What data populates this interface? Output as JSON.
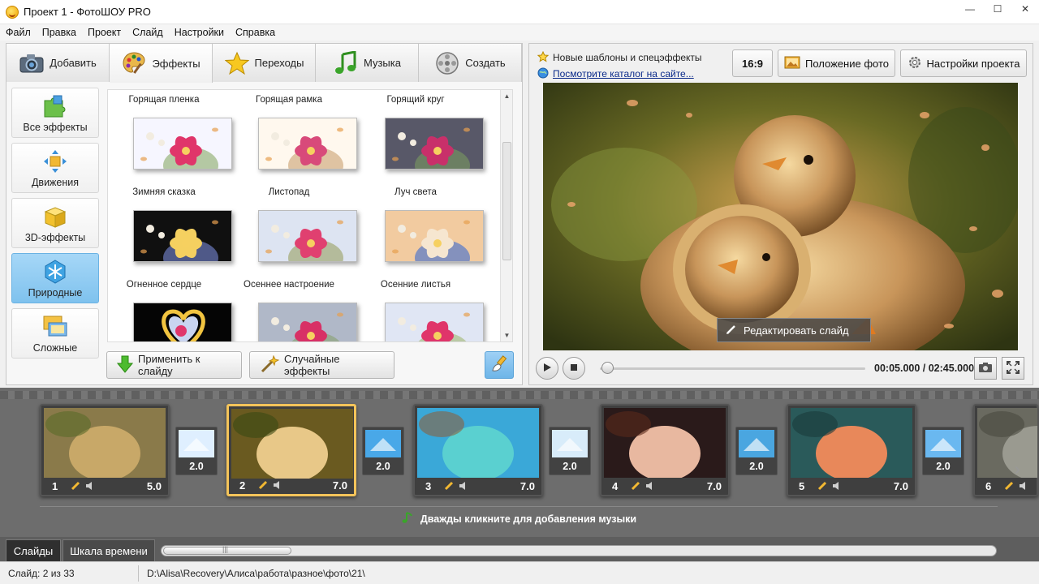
{
  "window": {
    "title": "Проект 1 - ФотоШОУ PRO",
    "min": "—",
    "max": "☐",
    "close": "✕"
  },
  "menu": [
    "Файл",
    "Правка",
    "Проект",
    "Слайд",
    "Настройки",
    "Справка"
  ],
  "tabs": [
    {
      "label": "Добавить",
      "icon": "camera-icon",
      "active": false
    },
    {
      "label": "Эффекты",
      "icon": "palette-icon",
      "active": true
    },
    {
      "label": "Переходы",
      "icon": "star-icon",
      "active": false
    },
    {
      "label": "Музыка",
      "icon": "music-note-icon",
      "active": false
    },
    {
      "label": "Создать",
      "icon": "film-reel-icon",
      "active": false
    }
  ],
  "categories": [
    {
      "label": "Все эффекты",
      "icon": "puzzle-icon",
      "active": false
    },
    {
      "label": "Движения",
      "icon": "move-arrows-icon",
      "active": false
    },
    {
      "label": "3D-эффекты",
      "icon": "cube-icon",
      "active": false
    },
    {
      "label": "Природные",
      "icon": "snowflake-icon",
      "active": true
    },
    {
      "label": "Сложные",
      "icon": "layered-frames-icon",
      "active": false
    }
  ],
  "effects": {
    "rows": [
      [
        "Горящая пленка",
        "Горящая рамка",
        "Горящий круг"
      ],
      [
        "Зимняя сказка",
        "Листопад",
        "Луч света"
      ],
      [
        "Огненное сердце",
        "Осеннее настроение",
        "Осенние листья"
      ]
    ]
  },
  "actions": {
    "apply": "Применить к слайду",
    "random": "Случайные эффекты"
  },
  "news": {
    "line1": "Новые шаблоны и спецэффекты",
    "line2": "Посмотрите каталог на сайте..."
  },
  "preview_toolbar": {
    "ratio": "16:9",
    "photo_position": "Положение фото",
    "project_settings": "Настройки проекта"
  },
  "preview": {
    "edit_slide": "Редактировать слайд"
  },
  "player": {
    "timecode": "00:05.000 / 02:45.000",
    "progress": 0.03
  },
  "slides": [
    {
      "num": "1",
      "duration": "5.0",
      "active": false
    },
    {
      "num": "2",
      "duration": "7.0",
      "active": true
    },
    {
      "num": "3",
      "duration": "7.0",
      "active": false
    },
    {
      "num": "4",
      "duration": "7.0",
      "active": false
    },
    {
      "num": "5",
      "duration": "7.0",
      "active": false
    },
    {
      "num": "6",
      "duration": "",
      "active": false
    }
  ],
  "transitions": [
    "2.0",
    "2.0",
    "2.0",
    "2.0",
    "2.0"
  ],
  "music_hint": "Дважды кликните для добавления музыки",
  "bottom_tabs": {
    "slides": "Слайды",
    "timeline": "Шкала времени",
    "scroll_grip": "|||"
  },
  "status": {
    "slide": "Слайд: 2 из 33",
    "path": "D:\\Alisa\\Recovery\\Алиса\\работа\\разное\\фото\\21\\"
  }
}
